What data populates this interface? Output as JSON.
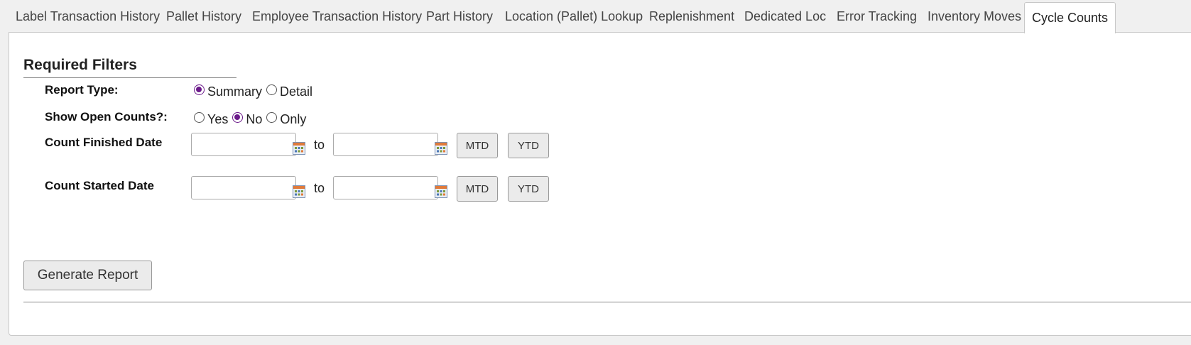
{
  "tabs": [
    {
      "label": "Label Transaction History"
    },
    {
      "label": "Pallet History"
    },
    {
      "label": "Employee Transaction History"
    },
    {
      "label": "Part History"
    },
    {
      "label": "Location (Pallet) Lookup"
    },
    {
      "label": "Replenishment"
    },
    {
      "label": "Dedicated Loc"
    },
    {
      "label": "Error Tracking"
    },
    {
      "label": "Inventory Moves"
    },
    {
      "label": "Cycle Counts"
    }
  ],
  "active_tab": "Cycle Counts",
  "filters": {
    "title": "Required Filters",
    "report_type": {
      "label": "Report Type:",
      "options": [
        "Summary",
        "Detail"
      ],
      "selected": "Summary"
    },
    "show_open_counts": {
      "label": "Show Open Counts?:",
      "options": [
        "Yes",
        "No",
        "Only"
      ],
      "selected": "No"
    },
    "count_finished_date": {
      "label": "Count Finished Date",
      "from_value": "",
      "to_value": "",
      "to_text": "to",
      "mtd_label": "MTD",
      "ytd_label": "YTD"
    },
    "count_started_date": {
      "label": "Count Started Date",
      "from_value": "",
      "to_value": "",
      "to_text": "to",
      "mtd_label": "MTD",
      "ytd_label": "YTD"
    }
  },
  "generate_label": "Generate Report",
  "colors": {
    "radio_accent": "#6b1a8a"
  },
  "icons": {
    "date_picker": "calendar-icon"
  }
}
